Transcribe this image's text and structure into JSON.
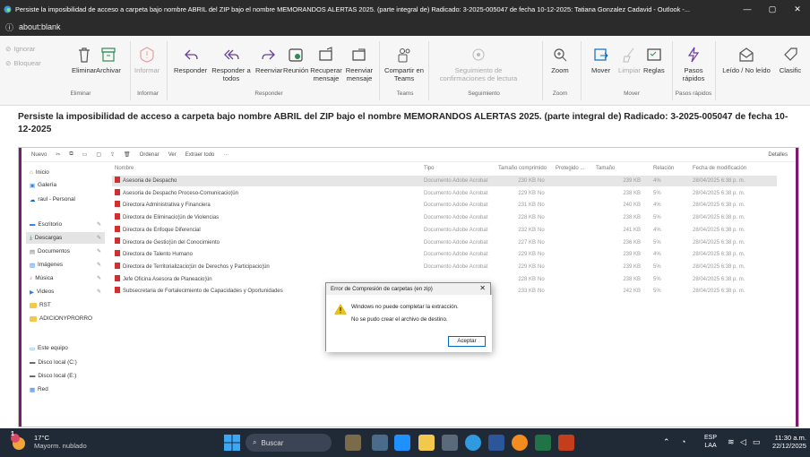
{
  "window": {
    "title": "Persiste la imposibilidad de acceso a carpeta bajo nombre ABRIL  del ZIP bajo el nombre  MEMORANDOS ALERTAS 2025. (parte integral de) Radicado: 3-2025-005047 de fecha 10-12-2025: Tatiana Gonzalez Cadavid - Outlook -...",
    "minimize": "—",
    "maximize": "▢",
    "close": "✕"
  },
  "urlbar": {
    "info_icon": "ⓘ",
    "text": "about:blank"
  },
  "ribbon": {
    "small_left": {
      "ignorar": "Ignorar",
      "bloquear": "Bloquear"
    },
    "buttons": {
      "eliminar": "Eliminar",
      "archivar": "Archivar",
      "informar": "Informar",
      "responder": "Responder",
      "responder_todos": "Responder a todos",
      "reenviar": "Reenviar",
      "reunion": "Reunión",
      "recuperar": "Recuperar mensaje",
      "reenviar_mensaje": "Reenviar mensaje",
      "compartir": "Compartir en Teams",
      "seguimiento": "Seguimiento de confirmaciones de lectura",
      "zoom": "Zoom",
      "mover": "Mover",
      "limpiar": "Limpiar",
      "reglas": "Reglas",
      "pasos": "Pasos rápidos",
      "leido": "Leído / No leído",
      "clasificar": "Clasific"
    },
    "groups": {
      "eliminar": "Eliminar",
      "informar": "Informar",
      "responder": "Responder",
      "teams": "Teams",
      "seguimiento": "Seguimiento",
      "zoom": "Zoom",
      "mover": "Mover",
      "pasos": "Pasos rápidos"
    }
  },
  "subject": "Persiste la imposibilidad de acceso a  carpeta bajo nombre  ABRIL  del ZIP bajo el nombre  MEMORANDOS ALERTAS 2025. (parte integral de) Radicado: 3-2025-005047 de fecha 10-12-2025",
  "explorer": {
    "toolbar": {
      "nuevo": "Nuevo",
      "ordenar": "Ordenar",
      "ver": "Ver",
      "extraer": "Extraer todo",
      "more": "···",
      "detalles": "Detalles"
    },
    "nav": [
      {
        "label": "Inicio",
        "pinned": false
      },
      {
        "label": "Galería",
        "pinned": false
      },
      {
        "label": "raul - Personal",
        "pinned": false
      },
      {
        "label": "Escritorio",
        "pinned": true
      },
      {
        "label": "Descargas",
        "pinned": true
      },
      {
        "label": "Documentos",
        "pinned": true
      },
      {
        "label": "Imágenes",
        "pinned": true
      },
      {
        "label": "Música",
        "pinned": true
      },
      {
        "label": "Videos",
        "pinned": true
      },
      {
        "label": "RST",
        "pinned": false
      },
      {
        "label": "ADICIONYPRORRO",
        "pinned": false
      },
      {
        "label": "Este equipo",
        "pinned": false
      },
      {
        "label": "Disco local (C:)",
        "pinned": false
      },
      {
        "label": "Disco local (E:)",
        "pinned": false
      },
      {
        "label": "Red",
        "pinned": false
      }
    ],
    "columns": {
      "nombre": "Nombre",
      "tipo": "Tipo",
      "comprimido": "Tamaño comprimido",
      "protegido": "Protegido ...",
      "tamano": "Tamaño",
      "relacion": "Relación",
      "fecha": "Fecha de modificación"
    },
    "rows": [
      {
        "name": "Asesoria de Despacho",
        "type": "Documento Adobe Acrobat",
        "comp": "230 KB",
        "prot": "No",
        "size": "239 KB",
        "ratio": "4%",
        "date": "28/04/2025 6:38 p. m."
      },
      {
        "name": "Asesoria de Despacho Proceso-Comunicacio¦ün",
        "type": "Documento Adobe Acrobat",
        "comp": "229 KB",
        "prot": "No",
        "size": "238 KB",
        "ratio": "5%",
        "date": "28/04/2025 6:38 p. m."
      },
      {
        "name": "Directora Administrativa y Financiera",
        "type": "Documento Adobe Acrobat",
        "comp": "231 KB",
        "prot": "No",
        "size": "240 KB",
        "ratio": "4%",
        "date": "28/04/2025 6:38 p. m."
      },
      {
        "name": "Directora de Eliminacio¦ün de Violencias",
        "type": "Documento Adobe Acrobat",
        "comp": "228 KB",
        "prot": "No",
        "size": "238 KB",
        "ratio": "5%",
        "date": "28/04/2025 6:38 p. m."
      },
      {
        "name": "Directora de Enfoque Diferencial",
        "type": "Documento Adobe Acrobat",
        "comp": "232 KB",
        "prot": "No",
        "size": "241 KB",
        "ratio": "4%",
        "date": "28/04/2025 6:38 p. m."
      },
      {
        "name": "Directora de Gestio¦ün del Conocimiento",
        "type": "Documento Adobe Acrobat",
        "comp": "227 KB",
        "prot": "No",
        "size": "236 KB",
        "ratio": "5%",
        "date": "28/04/2025 6:38 p. m."
      },
      {
        "name": "Directora de Talento Humano",
        "type": "Documento Adobe Acrobat",
        "comp": "229 KB",
        "prot": "No",
        "size": "239 KB",
        "ratio": "4%",
        "date": "28/04/2025 6:38 p. m."
      },
      {
        "name": "Directora de Territorializacio¦ün de Derechos y Participacio¦ün",
        "type": "Documento Adobe Acrobat",
        "comp": "229 KB",
        "prot": "No",
        "size": "239 KB",
        "ratio": "5%",
        "date": "28/04/2025 6:38 p. m."
      },
      {
        "name": "Jefe Oficina Asesora de Planeacio¦ün",
        "type": "",
        "comp": "228 KB",
        "prot": "No",
        "size": "238 KB",
        "ratio": "5%",
        "date": "28/04/2025 6:38 p. m."
      },
      {
        "name": "Subsecretaria de Fortalecimiento de Capacidades y Oportunidades",
        "type": "",
        "comp": "233 KB",
        "prot": "No",
        "size": "242 KB",
        "ratio": "5%",
        "date": "28/04/2025 6:38 p. m."
      }
    ]
  },
  "dialog": {
    "title": "Error de Compresión de carpetas (en zip)",
    "close": "✕",
    "message1": "Windows no puede completar la extracción.",
    "message2": "No se pudo crear el archivo de destino.",
    "button": "Aceptar"
  },
  "taskbar": {
    "temp": "17°C",
    "weather": "Mayorm. nublado",
    "badge": "1",
    "search": "Buscar",
    "lang1": "ESP",
    "lang2": "LAA",
    "time": "11:30 a.m.",
    "date": "22/12/2025"
  }
}
